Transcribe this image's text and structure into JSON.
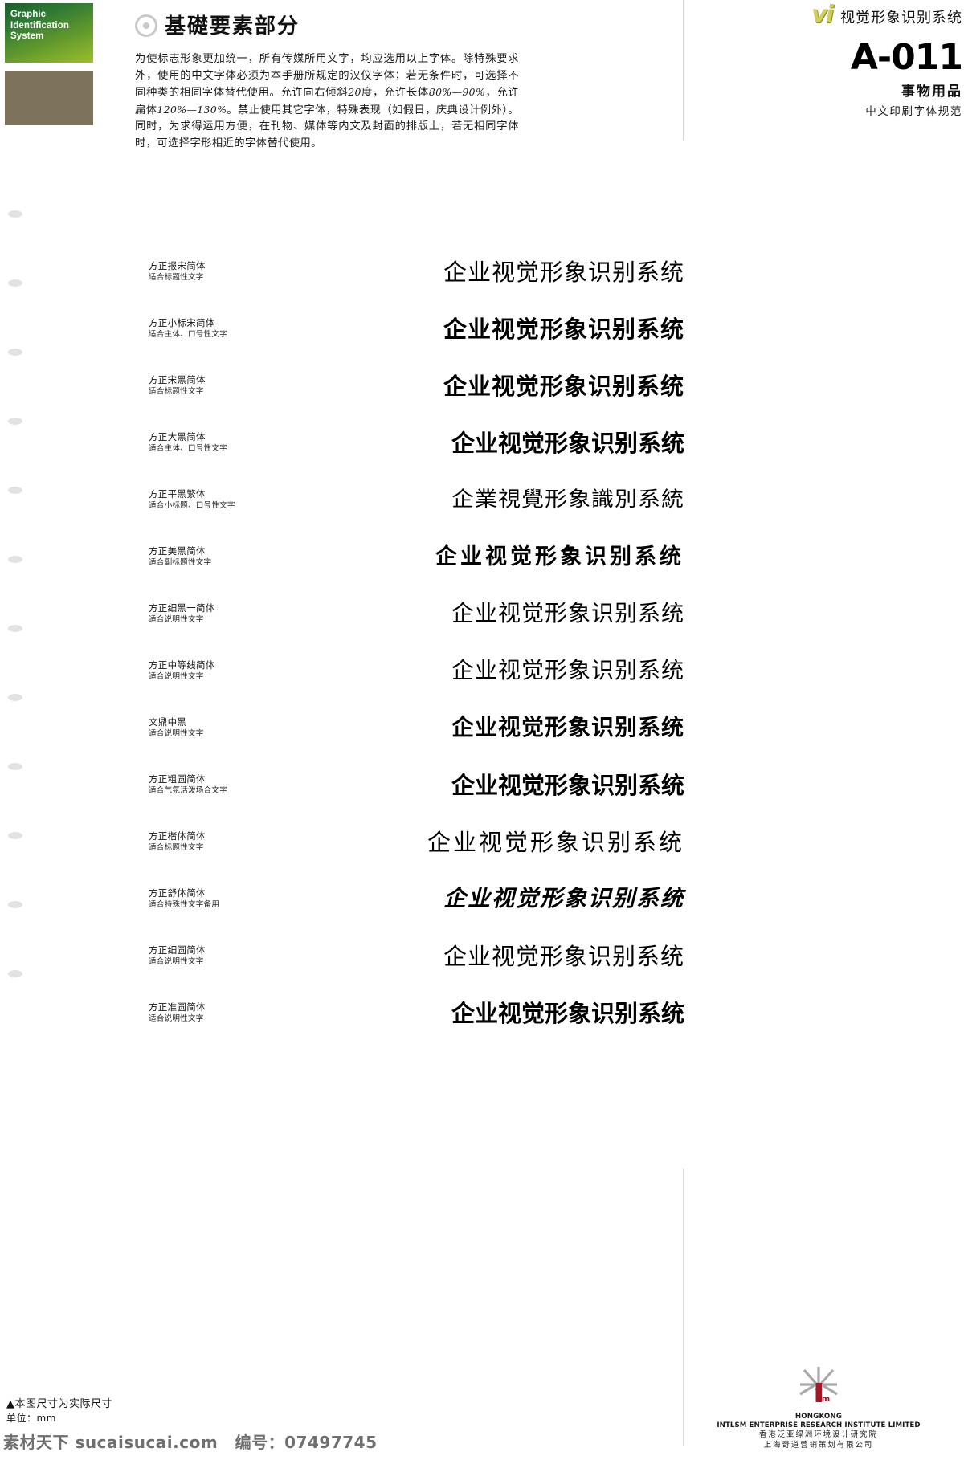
{
  "brand_block": {
    "line1": "Graphic",
    "line2": "Identification",
    "line3": "System",
    "gradient_from": "#1d5c2f",
    "gradient_to": "#9cbf2c",
    "swatch_color": "#7d735c"
  },
  "header": {
    "ring_icon": "target-ring-icon",
    "title": "基礎要素部分",
    "vi_mark": "vi",
    "vi_mark_color": "#cfcf5a",
    "system_name": "视觉形象识别系统",
    "page_code": "A-011",
    "section": "事物用品",
    "subsection": "中文印刷字体规范"
  },
  "intro": {
    "p1": "为使标志形象更加统一，所有传媒所用文字，均应选用以上字体。除特殊要求外，使用的中文字体必须为本手册所规定的汉仪字体；若无条件时，可选择不同种类的相同字体替代使用。允许向右倾斜",
    "i1": "20",
    "p2": "度，允许长体",
    "i2": "80%—90%",
    "p3": "，允许扁体",
    "i3": "120%—130%",
    "p4": "。禁止使用其它字体，特殊表现（如假日，庆典设计例外）。同时，为求得运用方便，在刊物、媒体等内文及封面的排版上，若无相同字体时，可选择字形相近的字体替代使用。"
  },
  "specimen_text": "企业视觉形象识别系统",
  "specimen_text_traditional": "企業視覺形象識別系統",
  "fonts": [
    {
      "name": "方正报宋简体",
      "use": "适合标题性文字",
      "style": "s-songti",
      "sample": "企业视觉形象识别系统"
    },
    {
      "name": "方正小标宋简体",
      "use": "适合主体、口号性文字",
      "style": "s-songti-b",
      "sample": "企业视觉形象识别系统"
    },
    {
      "name": "方正宋黑简体",
      "use": "适合标题性文字",
      "style": "s-songhei",
      "sample": "企业视觉形象识别系统"
    },
    {
      "name": "方正大黑简体",
      "use": "适合主体、口号性文字",
      "style": "s-dahei",
      "sample": "企业视觉形象识别系统"
    },
    {
      "name": "方正平黑繁体",
      "use": "适合小标题、口号性文字",
      "style": "s-pinghei",
      "sample": "企業視覺形象識別系統"
    },
    {
      "name": "方正美黑简体",
      "use": "适合副标题性文字",
      "style": "s-meihei",
      "sample": "企业视觉形象识别系统"
    },
    {
      "name": "方正细黑一简体",
      "use": "适合说明性文字",
      "style": "s-xihei",
      "sample": "企业视觉形象识别系统"
    },
    {
      "name": "方正中等线简体",
      "use": "适合说明性文字",
      "style": "s-dengxian",
      "sample": "企业视觉形象识别系统"
    },
    {
      "name": "文鼎中黑",
      "use": "适合说明性文字",
      "style": "s-zhonghei",
      "sample": "企业视觉形象识别系统"
    },
    {
      "name": "方正粗圆简体",
      "use": "适合气氛活泼场合文字",
      "style": "s-cuyuan",
      "sample": "企业视觉形象识别系统"
    },
    {
      "name": "方正楷体简体",
      "use": "适合标题性文字",
      "style": "s-kaiti",
      "sample": "企业视觉形象识别系统"
    },
    {
      "name": "方正舒体简体",
      "use": "适合特殊性文字备用",
      "style": "s-shuti",
      "sample": "企业视觉形象识别系统"
    },
    {
      "name": "方正细圆简体",
      "use": "适合说明性文字",
      "style": "s-xiyuan",
      "sample": "企业视觉形象识别系统"
    },
    {
      "name": "方正准圆简体",
      "use": "适合说明性文字",
      "style": "s-zhunyuan",
      "sample": "企业视觉形象识别系统"
    }
  ],
  "footer": {
    "note_line1": "▲本图尺寸为实际尺寸",
    "note_line2": "单位：mm",
    "watermark_site": "素材天下 sucaisucai.com",
    "watermark_id_label": "编号：",
    "watermark_id": "07497745",
    "company": {
      "logo_icon": "starburst-lsm-logo-icon",
      "logo_accent_color": "#a31529",
      "logo_ray_color": "#a8a8a8",
      "en_line1": "HONGKONG",
      "en_line2": "INTLSM ENTERPRISE RESEARCH INSTITUTE LIMITED",
      "cn_line1": "香港泛亚绿洲环境设计研究院",
      "cn_line2": "上海奇道营销策划有限公司"
    }
  },
  "punch_hole_count": 12
}
